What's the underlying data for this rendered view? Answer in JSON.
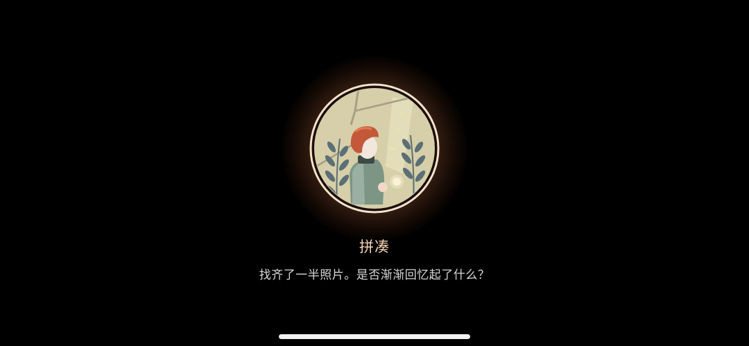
{
  "achievement": {
    "title": "拼凑",
    "description": "找齐了一半照片。是否渐渐回忆起了什么？",
    "badge_icon": "boy-with-butterflies-badge-icon"
  },
  "colors": {
    "background": "#000000",
    "title": "#f4d3b4",
    "description": "#d8d8d8",
    "badge_ring": "#f7e3cc",
    "badge_glow": "#ff9a5a",
    "badge_fill": "#d8d1ad",
    "hair": "#c4583a",
    "coat": "#7d9585",
    "leaves": "#5c6f75"
  },
  "system": {
    "home_indicator_icon": "home-indicator"
  }
}
